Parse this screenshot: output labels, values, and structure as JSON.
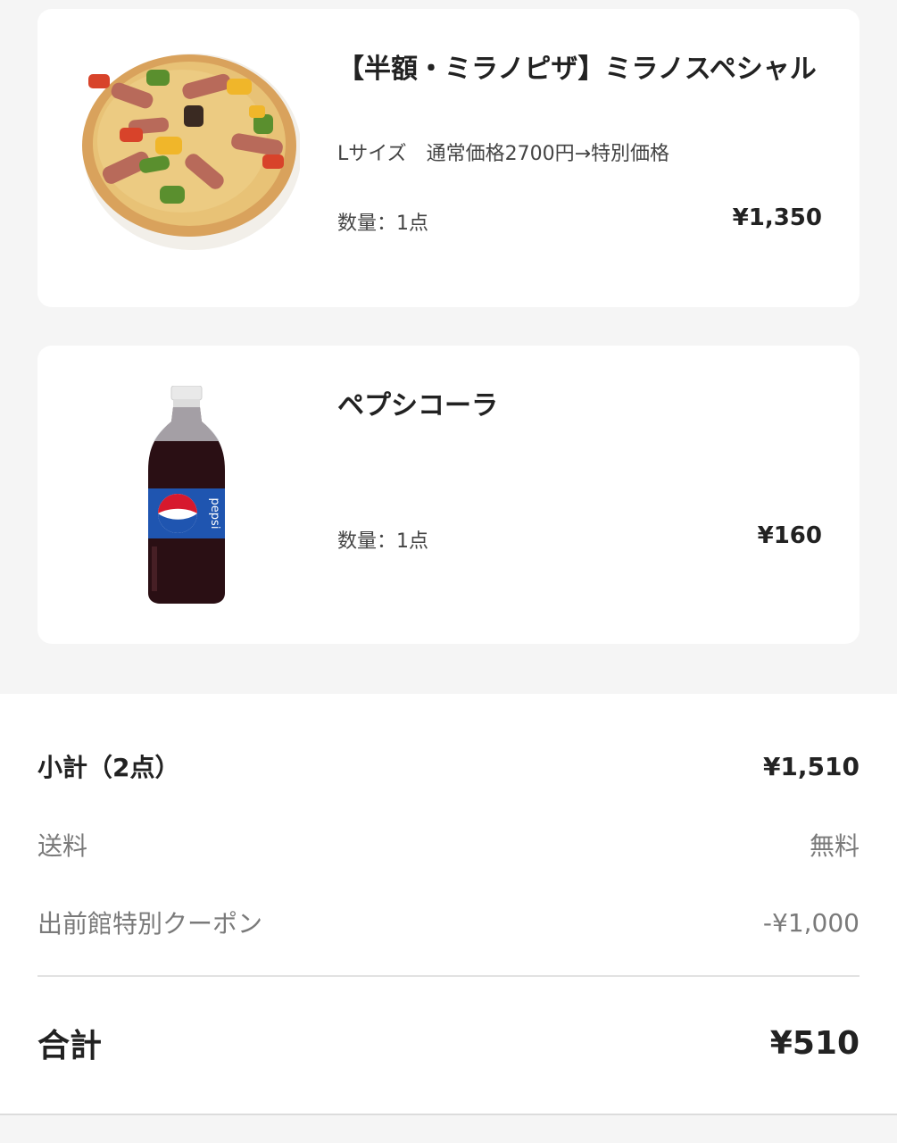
{
  "items": [
    {
      "name": "【半額・ミラノピザ】ミラノスペシャル",
      "description": "Lサイズ　通常価格2700円→特別価格",
      "quantity": "数量：1点",
      "price": "¥1,350",
      "image_icon": "pizza-image"
    },
    {
      "name": "ペプシコーラ",
      "quantity": "数量：1点",
      "price": "¥160",
      "image_icon": "pepsi-bottle-image",
      "bottle_label": "pepsi"
    }
  ],
  "summary": {
    "subtotal_label": "小計（2点）",
    "subtotal_value": "¥1,510",
    "shipping_label": "送料",
    "shipping_value": "無料",
    "coupon_label": "出前館特別クーポン",
    "coupon_value": "-¥1,000",
    "total_label": "合計",
    "total_value": "¥510"
  }
}
